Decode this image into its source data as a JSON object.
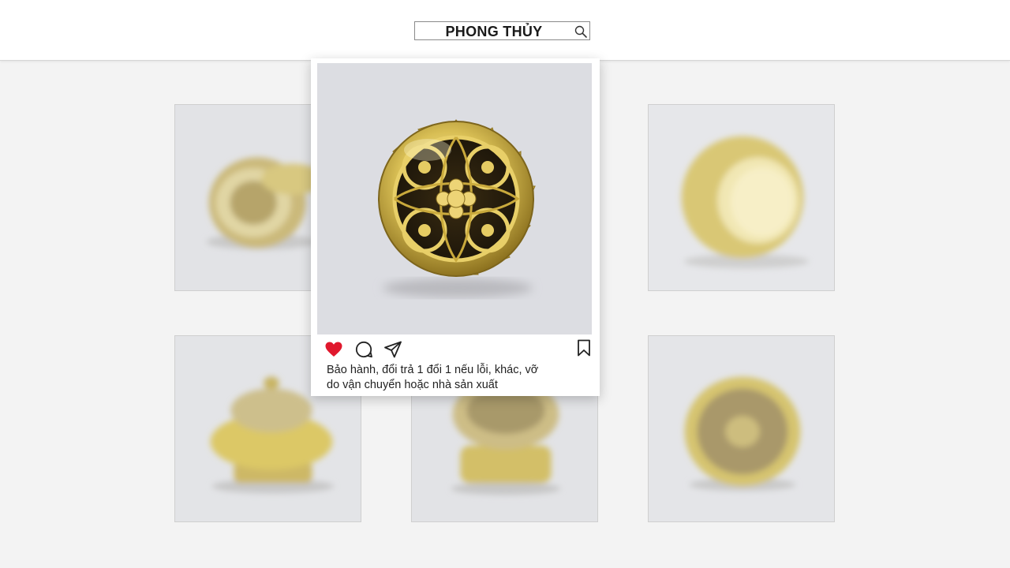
{
  "header": {
    "search_text": "PHONG THỦY",
    "icon": "search-icon"
  },
  "gallery": {
    "tiles": [
      {
        "name": "tile-lotus-censer-tilted",
        "subject": "gold lotus incense burner, tilted view"
      },
      {
        "name": "tile-lotus-censer-base",
        "subject": "gold lotus incense burner, base view"
      },
      {
        "name": "tile-lotus-censer-side",
        "subject": "gold lotus incense burner, side view"
      },
      {
        "name": "tile-lotus-censer-front",
        "subject": "gold lotus incense burner, front view"
      },
      {
        "name": "tile-lotus-censer-lid",
        "subject": "gold lotus incense burner, lid view"
      },
      {
        "name": "tile-lotus-censer-back",
        "subject": "gold lotus incense burner, behind card"
      }
    ]
  },
  "post": {
    "icons": [
      "heart-icon",
      "comment-icon",
      "share-icon",
      "bookmark-icon"
    ],
    "liked": true,
    "caption_line1": "Bảo hành, đổi trả 1 đổi 1 nếu lỗi, khác, vỡ",
    "caption_line2": "do vận chuyển hoặc nhà sản xuất"
  },
  "colors": {
    "heart": "#e0182d",
    "gold": "#d8c25c",
    "background": "#f3f3f3"
  }
}
